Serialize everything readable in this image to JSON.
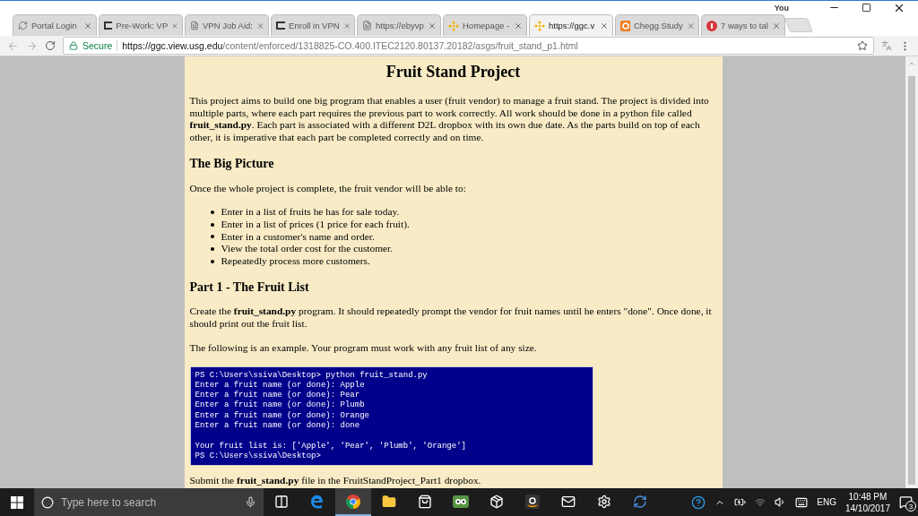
{
  "window": {
    "user": "You"
  },
  "tabs": [
    {
      "title": "Portal Login",
      "selected": false
    },
    {
      "title": "Pre-Work: VP",
      "selected": false
    },
    {
      "title": "VPN Job Aid:",
      "selected": false
    },
    {
      "title": "Enroll in VPN",
      "selected": false
    },
    {
      "title": "https://ebyvp",
      "selected": false
    },
    {
      "title": "Homepage -",
      "selected": false
    },
    {
      "title": "https://ggc.v",
      "selected": true
    },
    {
      "title": "Chegg Study",
      "selected": false
    },
    {
      "title": "7 ways to tal",
      "selected": false
    }
  ],
  "address_bar": {
    "security": "Secure",
    "url_host": "https://ggc.view.usg.edu",
    "url_path": "/content/enforced/1318825-CO.400.ITEC2120.80137.20182/asgs/fruit_stand_p1.html"
  },
  "page": {
    "title": "Fruit Stand Project",
    "sections": [
      {
        "kind": "paragraph",
        "text": "This project aims to build one big program that enables a user (fruit vendor) to manage a fruit stand. The project is divided into multiple parts, where each part requires the previous part to work correctly. All work should be done in a python file called **fruit_stand.py**. Each part is associated with a different D2L dropbox with its own due date. As the parts build on top of each other, it is imperative that each part be completed correctly and on time."
      },
      {
        "kind": "heading",
        "text": "The Big Picture"
      },
      {
        "kind": "paragraph",
        "text": "Once the whole project is complete, the fruit vendor will be able to:"
      },
      {
        "kind": "list",
        "items": [
          "Enter in a list of fruits he has for sale today.",
          "Enter in a list of prices (1 price for each fruit).",
          "Enter in a customer's name and order.",
          "View the total order cost for the customer.",
          "Repeatedly process more customers."
        ]
      },
      {
        "kind": "heading",
        "text": "Part 1 - The Fruit List"
      },
      {
        "kind": "paragraph",
        "text": "Create the **fruit_stand.py** program. It should repeatedly prompt the vendor for fruit names until he enters \"done\". Once done, it should print out the fruit list."
      },
      {
        "kind": "paragraph",
        "text": "The following is an example. Your program must work with any fruit list of any size."
      },
      {
        "kind": "console",
        "blocks": [
          [
            "PS C:\\Users\\ssiva\\Desktop> python fruit_stand.py",
            "Enter a fruit name (or done): Apple",
            "Enter a fruit name (or done): Pear",
            "Enter a fruit name (or done): Plumb",
            "Enter a fruit name (or done): Orange",
            "Enter a fruit name (or done): done"
          ],
          [
            "Your fruit list is: ['Apple', 'Pear', 'Plumb', 'Orange']",
            "PS C:\\Users\\ssiva\\Desktop>"
          ]
        ]
      },
      {
        "kind": "paragraph",
        "text": "Submit the **fruit_stand.py** file in the FruitStandProject_Part1 dropbox."
      }
    ]
  },
  "taskbar": {
    "search_placeholder": "Type here to search",
    "apps": [
      {
        "active": false
      },
      {
        "active": false
      },
      {
        "active": true
      },
      {
        "active": false
      },
      {
        "active": false
      },
      {
        "active": false
      },
      {
        "active": false
      },
      {
        "active": false
      },
      {
        "active": false
      },
      {
        "active": false
      },
      {
        "active": false
      }
    ],
    "language": "ENG",
    "time": "10:48 PM",
    "date": "14/10/2017",
    "notifications": "3"
  }
}
